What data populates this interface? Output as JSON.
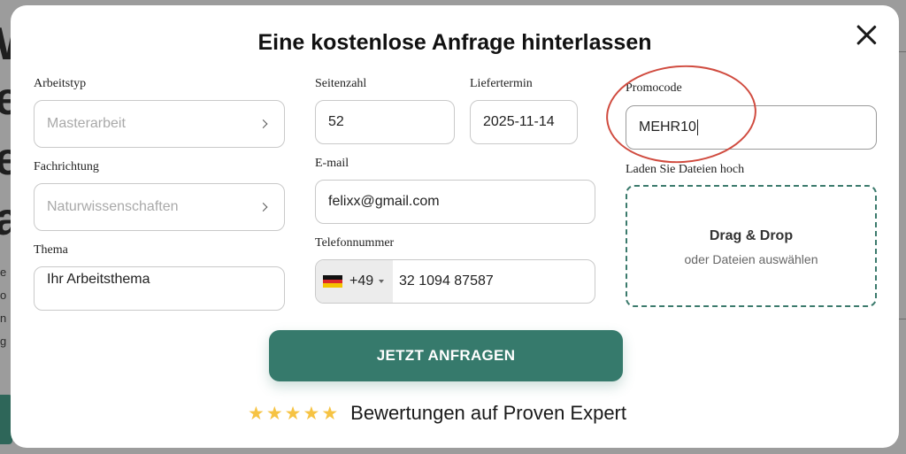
{
  "modal": {
    "title": "Eine kostenlose Anfrage hinterlassen",
    "close_icon": "close-icon"
  },
  "form": {
    "arbeitstyp": {
      "label": "Arbeitstyp",
      "value": "Masterarbeit"
    },
    "fachrichtung": {
      "label": "Fachrichtung",
      "value": "Naturwissenschaften"
    },
    "thema": {
      "label": "Thema",
      "value": "Ihr Arbeitsthema"
    },
    "seitenzahl": {
      "label": "Seitenzahl",
      "value": "52"
    },
    "liefertermin": {
      "label": "Liefertermin",
      "value": "2025-11-14"
    },
    "email": {
      "label": "E-mail",
      "value": "felixx@gmail.com"
    },
    "telefon": {
      "label": "Telefonnummer",
      "country_flag": "germany-flag",
      "dial_code": "+49",
      "number": "32 1094 87587"
    },
    "promocode": {
      "label": "Promocode",
      "value": "MEHR10"
    },
    "upload": {
      "label": "Laden Sie Dateien hoch",
      "title": "Drag & Drop",
      "subtitle": "oder Dateien auswählen"
    },
    "submit_label": "JETZT ANFRAGEN"
  },
  "rating": {
    "stars": 5,
    "star_color": "#f6c343",
    "text": "Bewertungen auf Proven Expert"
  },
  "colors": {
    "accent": "#367a6c",
    "highlight_ellipse": "#d04b3f"
  }
}
